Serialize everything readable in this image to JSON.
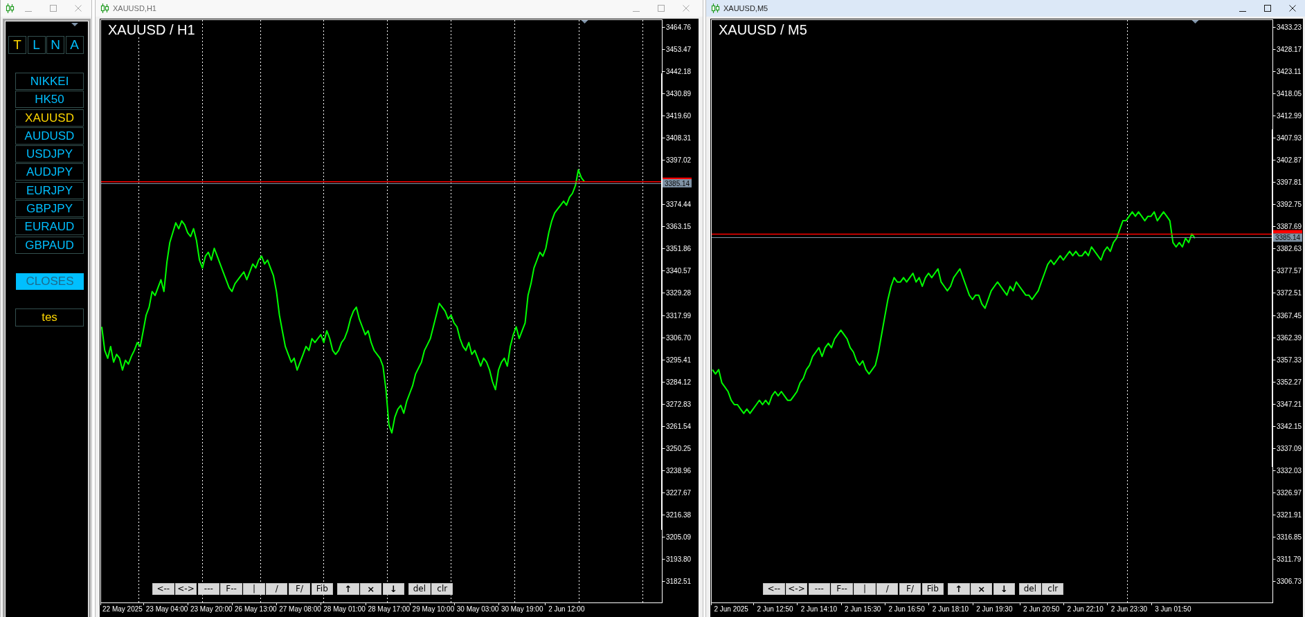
{
  "panel_window": {
    "active": false,
    "mode_buttons": [
      {
        "label": "T",
        "selected": true
      },
      {
        "label": "L",
        "selected": false
      },
      {
        "label": "N",
        "selected": false
      },
      {
        "label": "A",
        "selected": false
      }
    ],
    "symbols": [
      {
        "label": "NIKKEI",
        "selected": false
      },
      {
        "label": "HK50",
        "selected": false
      },
      {
        "label": "XAUUSD",
        "selected": true
      },
      {
        "label": "AUDUSD",
        "selected": false
      },
      {
        "label": "USDJPY",
        "selected": false
      },
      {
        "label": "AUDJPY",
        "selected": false
      },
      {
        "label": "EURJPY",
        "selected": false
      },
      {
        "label": "GBPJPY",
        "selected": false
      },
      {
        "label": "EURAUD",
        "selected": false
      },
      {
        "label": "GBPAUD",
        "selected": false
      }
    ],
    "close_button": {
      "label": "CLOSES"
    },
    "test_button": {
      "label": "tes"
    }
  },
  "chart_windows": [
    {
      "title": "XAUUSD,H1",
      "active": false,
      "toolbar": [
        {
          "kind": "draw",
          "buttons": [
            {
              "label": "<--"
            },
            {
              "label": "<->"
            },
            {
              "label": "---"
            },
            {
              "label": "F--"
            },
            {
              "label": "|"
            },
            {
              "label": "/"
            },
            {
              "label": "F/"
            },
            {
              "label": "Fib"
            }
          ]
        },
        {
          "kind": "order",
          "buttons": [
            {
              "label": "↑"
            },
            {
              "label": "×"
            },
            {
              "label": "↓"
            }
          ]
        },
        {
          "kind": "edit",
          "buttons": [
            {
              "label": "del"
            },
            {
              "label": "clr"
            }
          ]
        }
      ],
      "chart_data": {
        "type": "line",
        "title": "XAUUSD / H1",
        "ylim": [
          3171.59,
          3468.28
        ],
        "categories": [
          null,
          null,
          null,
          null,
          null,
          null,
          null,
          "22 May 2025",
          null,
          null,
          null,
          null,
          null,
          null,
          null,
          null,
          null,
          null,
          null,
          null,
          null,
          null,
          "23 May 04:00",
          null,
          null,
          null,
          null,
          null,
          null,
          null,
          null,
          null,
          null,
          null,
          null,
          null,
          null,
          "23 May 20:00",
          null,
          null,
          null,
          null,
          null,
          null,
          null,
          null,
          null,
          null,
          null,
          null,
          null,
          null,
          "26 May 13:00",
          null,
          null,
          null,
          null,
          null,
          null,
          null,
          null,
          null,
          null,
          null,
          null,
          null,
          null,
          "27 May 08:00",
          null,
          null,
          null,
          null,
          null,
          null,
          null,
          null,
          null,
          null,
          null,
          null,
          null,
          null,
          "28 May 01:00",
          null,
          null,
          null,
          null,
          null,
          null,
          null,
          null,
          null,
          null,
          null,
          null,
          null,
          null,
          "28 May 17:00",
          null,
          null,
          null,
          null,
          null,
          null,
          null,
          null,
          null,
          null,
          null,
          null,
          null,
          null,
          "29 May 10:00",
          null,
          null,
          null,
          null,
          null,
          null,
          null,
          null,
          null,
          null,
          null,
          null,
          null,
          null,
          "30 May 03:00",
          null,
          null,
          null,
          null,
          null,
          null,
          null,
          null,
          null,
          null,
          null,
          null,
          null,
          null,
          "30 May 19:00",
          null,
          null,
          null,
          null,
          null,
          null,
          null,
          null,
          null,
          null,
          null,
          null,
          null,
          null,
          "2 Jun 12:00",
          null,
          null,
          null,
          null,
          null,
          null
        ],
        "values": [
          3312,
          3300,
          3296,
          3302,
          3294,
          3298,
          3296,
          3290,
          3295,
          3293,
          3297,
          3300,
          3304,
          3302,
          3310,
          3318,
          3322,
          3330,
          3328,
          3332,
          3336,
          3330,
          3345,
          3355,
          3360,
          3365,
          3362,
          3366,
          3364,
          3360,
          3358,
          3362,
          3356,
          3346,
          3342,
          3348,
          3350,
          3346,
          3352,
          3348,
          3344,
          3340,
          3336,
          3332,
          3330,
          3334,
          3336,
          3338,
          3340,
          3336,
          3340,
          3344,
          3342,
          3346,
          3348,
          3344,
          3346,
          3342,
          3338,
          3330,
          3318,
          3310,
          3302,
          3298,
          3294,
          3296,
          3290,
          3294,
          3298,
          3302,
          3300,
          3306,
          3304,
          3306,
          3308,
          3304,
          3310,
          3306,
          3300,
          3298,
          3300,
          3304,
          3306,
          3310,
          3316,
          3320,
          3322,
          3316,
          3312,
          3308,
          3310,
          3304,
          3300,
          3298,
          3296,
          3292,
          3280,
          3262,
          3258,
          3266,
          3270,
          3272,
          3268,
          3274,
          3278,
          3282,
          3288,
          3291,
          3294,
          3300,
          3303,
          3306,
          3312,
          3318,
          3324,
          3322,
          3320,
          3316,
          3318,
          3314,
          3312,
          3306,
          3302,
          3300,
          3304,
          3298,
          3300,
          3296,
          3292,
          3296,
          3294,
          3290,
          3284,
          3280,
          3290,
          3294,
          3296,
          3292,
          3302,
          3308,
          3312,
          3306,
          3310,
          3314,
          3328,
          3334,
          3342,
          3346,
          3350,
          3348,
          3352,
          3360,
          3366,
          3370,
          3372,
          3374,
          3376,
          3374,
          3378,
          3380,
          3384,
          3392,
          3388,
          3386
        ],
        "yticks": [
          {
            "value": 3464.76,
            "label": "3464.76"
          },
          {
            "value": 3453.47,
            "label": "3453.47"
          },
          {
            "value": 3442.18,
            "label": "3442.18"
          },
          {
            "value": 3430.89,
            "label": "3430.89"
          },
          {
            "value": 3419.6,
            "label": "3419.60"
          },
          {
            "value": 3408.31,
            "label": "3408.31"
          },
          {
            "value": 3397.02,
            "label": "3397.02"
          },
          {
            "value": 3374.44,
            "label": "3374.44"
          },
          {
            "value": 3363.15,
            "label": "3363.15"
          },
          {
            "value": 3351.86,
            "label": "3351.86"
          },
          {
            "value": 3340.57,
            "label": "3340.57"
          },
          {
            "value": 3329.28,
            "label": "3329.28"
          },
          {
            "value": 3317.99,
            "label": "3317.99"
          },
          {
            "value": 3306.7,
            "label": "3306.70"
          },
          {
            "value": 3295.41,
            "label": "3295.41"
          },
          {
            "value": 3284.12,
            "label": "3284.12"
          },
          {
            "value": 3272.83,
            "label": "3272.83"
          },
          {
            "value": 3261.54,
            "label": "3261.54"
          },
          {
            "value": 3250.25,
            "label": "3250.25"
          },
          {
            "value": 3238.96,
            "label": "3238.96"
          },
          {
            "value": 3227.67,
            "label": "3227.67"
          },
          {
            "value": 3216.38,
            "label": "3216.38"
          },
          {
            "value": 3205.09,
            "label": "3205.09"
          },
          {
            "value": 3193.8,
            "label": "3193.80"
          },
          {
            "value": 3182.51,
            "label": "3182.51"
          }
        ],
        "ref_lines": [
          {
            "axis": "y",
            "value": 3385.92,
            "color": "#ff0000"
          },
          {
            "axis": "y",
            "value": 3385.14,
            "color": "#8093a6",
            "label": "3385.14"
          }
        ]
      }
    },
    {
      "title": "XAUUSD,M5",
      "active": true,
      "toolbar": [
        {
          "kind": "draw",
          "buttons": [
            {
              "label": "<--"
            },
            {
              "label": "<->"
            },
            {
              "label": "---"
            },
            {
              "label": "F--"
            },
            {
              "label": "|"
            },
            {
              "label": "/"
            },
            {
              "label": "F/"
            },
            {
              "label": "Fib"
            }
          ]
        },
        {
          "kind": "order",
          "buttons": [
            {
              "label": "↑"
            },
            {
              "label": "×"
            },
            {
              "label": "↓"
            }
          ]
        },
        {
          "kind": "edit",
          "buttons": [
            {
              "label": "del"
            },
            {
              "label": "clr"
            }
          ]
        }
      ],
      "chart_data": {
        "type": "line",
        "title": "XAUUSD / M5",
        "ylim": [
          3301.83,
          3434.81
        ],
        "categories": [
          null,
          null,
          null,
          null,
          null,
          null,
          "2 Jun 2025",
          null,
          null,
          null,
          null,
          null,
          null,
          null,
          null,
          null,
          null,
          null,
          null,
          null,
          "2 Jun 12:50",
          null,
          null,
          null,
          null,
          null,
          null,
          null,
          null,
          null,
          null,
          null,
          null,
          null,
          "2 Jun 14:10",
          null,
          null,
          null,
          null,
          null,
          null,
          null,
          null,
          null,
          null,
          null,
          null,
          null,
          "2 Jun 15:30",
          null,
          null,
          null,
          null,
          null,
          null,
          null,
          null,
          null,
          null,
          null,
          null,
          null,
          "2 Jun 16:50",
          null,
          null,
          null,
          null,
          null,
          null,
          null,
          null,
          null,
          null,
          null,
          null,
          null,
          "2 Jun 18:10",
          null,
          null,
          null,
          null,
          null,
          null,
          null,
          null,
          null,
          null,
          null,
          null,
          null,
          "2 Jun 19:30",
          null,
          null,
          null,
          null,
          null,
          null,
          null,
          null,
          null,
          null,
          null,
          null,
          null,
          null,
          "2 Jun 20:50",
          null,
          null,
          null,
          null,
          null,
          null,
          null,
          null,
          null,
          null,
          null,
          null,
          null,
          "2 Jun 22:10",
          null,
          null,
          null,
          null,
          null,
          null,
          null,
          null,
          null,
          null,
          null,
          null,
          null,
          "2 Jun 23:30",
          null,
          null,
          null,
          null,
          null,
          null,
          null,
          null,
          null,
          null,
          null,
          null,
          null,
          "3 Jun 01:50",
          null,
          null,
          null,
          null,
          null,
          null,
          null
        ],
        "values": [
          3355,
          3354,
          3355,
          3352,
          3351,
          3350,
          3348,
          3347,
          3347,
          3346,
          3345,
          3346,
          3345,
          3346,
          3347,
          3348,
          3347,
          3348,
          3347,
          3349,
          3350,
          3349,
          3350,
          3349,
          3348,
          3348,
          3349,
          3350,
          3352,
          3353,
          3355,
          3356,
          3358,
          3359,
          3360,
          3358,
          3360,
          3361,
          3360,
          3362,
          3363,
          3364,
          3363,
          3362,
          3360,
          3359,
          3357,
          3356,
          3357,
          3355,
          3354,
          3355,
          3356,
          3359,
          3363,
          3367,
          3371,
          3374,
          3376,
          3375,
          3375,
          3376,
          3375,
          3376,
          3377,
          3375,
          3376,
          3374,
          3376,
          3377,
          3376,
          3377,
          3378,
          3375,
          3374,
          3373,
          3374,
          3376,
          3377,
          3378,
          3376,
          3374,
          3372,
          3371,
          3372,
          3372,
          3370,
          3369,
          3371,
          3373,
          3374,
          3375,
          3374,
          3373,
          3372,
          3374,
          3373,
          3375,
          3374,
          3373,
          3372,
          3372,
          3371,
          3372,
          3373,
          3375,
          3377,
          3379,
          3380,
          3379,
          3380,
          3381,
          3380,
          3381,
          3382,
          3381,
          3382,
          3381,
          3381,
          3382,
          3381,
          3383,
          3382,
          3381,
          3380,
          3382,
          3383,
          3382,
          3384,
          3385,
          3387,
          3389,
          3389,
          3390,
          3391,
          3390,
          3391,
          3390,
          3389,
          3390,
          3390,
          3391,
          3389,
          3390,
          3391,
          3390,
          3389,
          3384,
          3383,
          3384,
          3383,
          3385,
          3384,
          3386,
          3385
        ],
        "yticks": [
          {
            "value": 3433.23,
            "label": "3433.23"
          },
          {
            "value": 3428.17,
            "label": "3428.17"
          },
          {
            "value": 3423.11,
            "label": "3423.11"
          },
          {
            "value": 3418.05,
            "label": "3418.05"
          },
          {
            "value": 3412.99,
            "label": "3412.99"
          },
          {
            "value": 3407.93,
            "label": "3407.93"
          },
          {
            "value": 3402.87,
            "label": "3402.87"
          },
          {
            "value": 3397.81,
            "label": "3397.81"
          },
          {
            "value": 3392.75,
            "label": "3392.75"
          },
          {
            "value": 3387.69,
            "label": "3387.69"
          },
          {
            "value": 3382.63,
            "label": "3382.63"
          },
          {
            "value": 3377.57,
            "label": "3377.57"
          },
          {
            "value": 3372.51,
            "label": "3372.51"
          },
          {
            "value": 3367.45,
            "label": "3367.45"
          },
          {
            "value": 3362.39,
            "label": "3362.39"
          },
          {
            "value": 3357.33,
            "label": "3357.33"
          },
          {
            "value": 3352.27,
            "label": "3352.27"
          },
          {
            "value": 3347.21,
            "label": "3347.21"
          },
          {
            "value": 3342.15,
            "label": "3342.15"
          },
          {
            "value": 3337.09,
            "label": "3337.09"
          },
          {
            "value": 3332.03,
            "label": "3332.03"
          },
          {
            "value": 3326.97,
            "label": "3326.97"
          },
          {
            "value": 3321.91,
            "label": "3321.91"
          },
          {
            "value": 3316.85,
            "label": "3316.85"
          },
          {
            "value": 3311.79,
            "label": "3311.79"
          },
          {
            "value": 3306.73,
            "label": "3306.73"
          }
        ],
        "ref_lines": [
          {
            "axis": "y",
            "value": 3385.92,
            "color": "#ff0000"
          },
          {
            "axis": "y",
            "value": 3385.14,
            "color": "#8093a6",
            "label": "3385.14"
          }
        ]
      }
    }
  ]
}
